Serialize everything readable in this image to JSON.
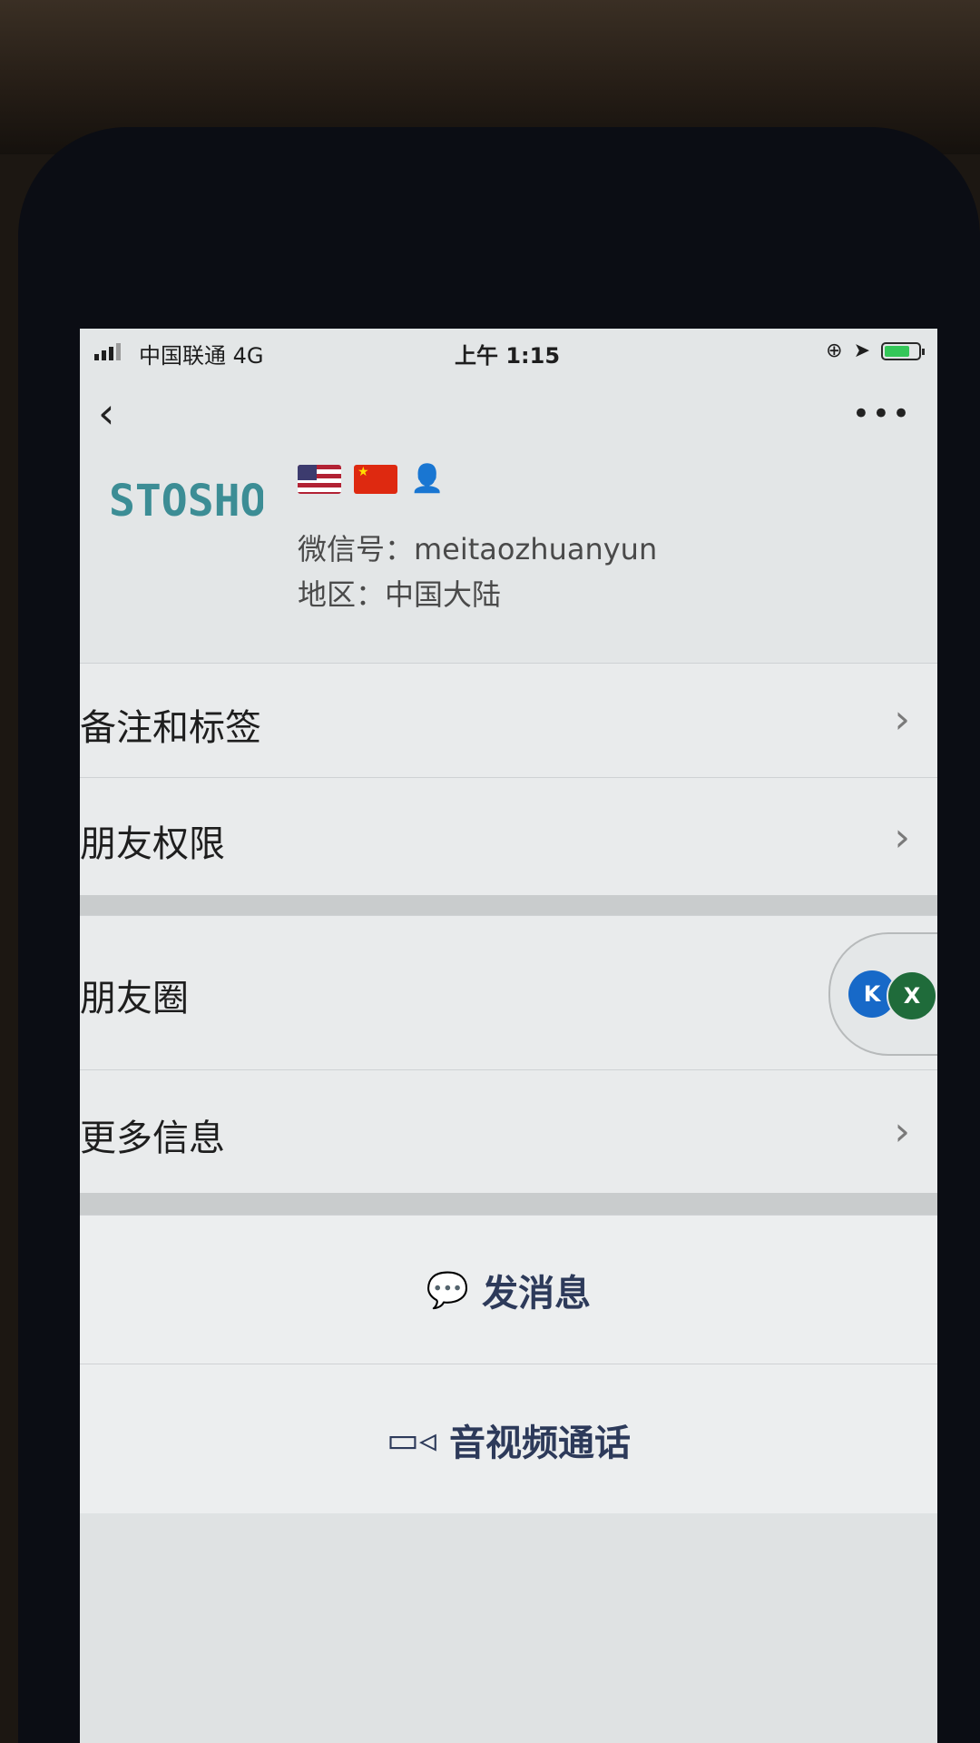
{
  "status_bar": {
    "carrier": "中国联通  4G",
    "time": "上午 1:15",
    "battery_level": 0.75
  },
  "nav": {
    "back_icon": "‹",
    "more_icon": "•••"
  },
  "profile": {
    "avatar_text": "STOSHO",
    "wechat_id": "微信号：meitaozhuanyun",
    "region": "地区：中国大陆",
    "nickname_icons": [
      "us-flag-icon",
      "china-flag-icon",
      "person-icon"
    ]
  },
  "rows": {
    "notes_tags": "备注和标签",
    "friend_permissions": "朋友权限",
    "moments": "朋友圈",
    "more_info": "更多信息",
    "chevron": "›"
  },
  "moments_thumbs": {
    "first": "K",
    "second": "X"
  },
  "actions": {
    "send_message": "发消息",
    "video_call": "音视频通话"
  }
}
